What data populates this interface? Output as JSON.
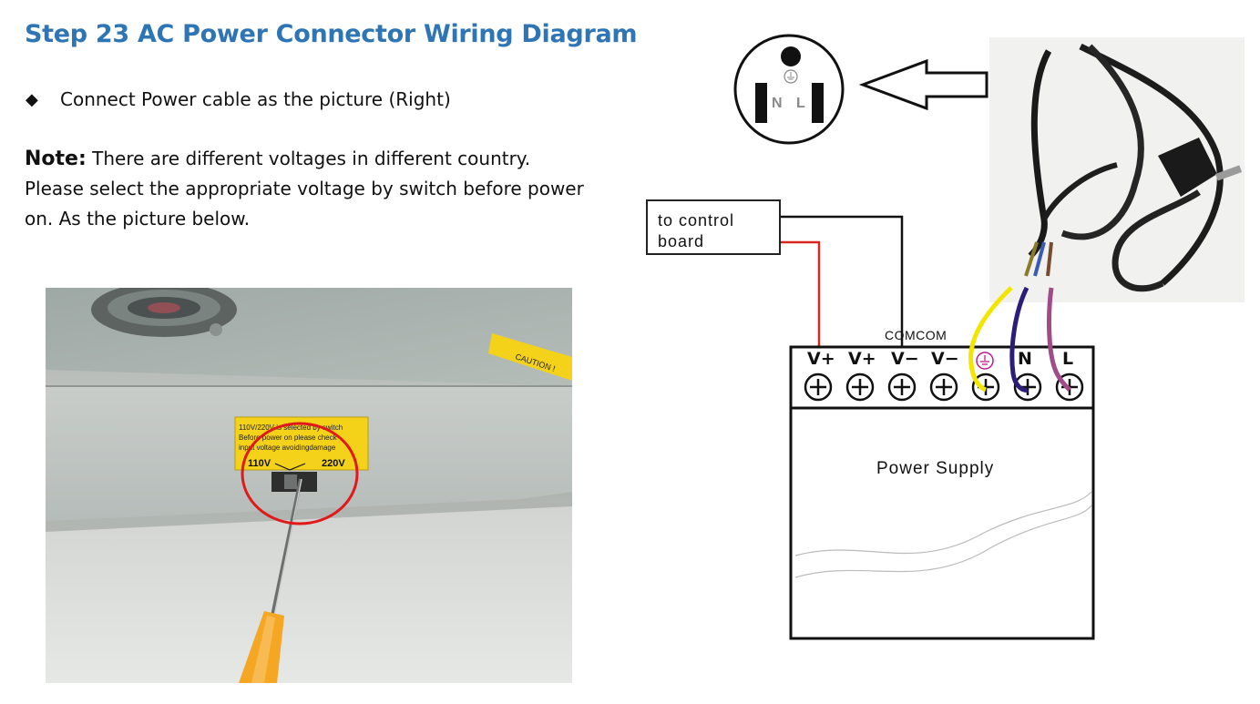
{
  "title": "Step 23  AC Power Connector Wiring Diagram",
  "bullet": {
    "symbol": "◆",
    "text": "Connect Power cable as the picture (Right)"
  },
  "note": {
    "label": "Note:",
    "text": " There are different voltages in different country. Please select the appropriate voltage by switch before power on. As the picture below."
  },
  "photo": {
    "caution_label": "CAUTION !",
    "switch_sticker_text": "110V/220V is selected by switch Before power on please check input voltage avoidingdamage",
    "switch_left": "110V",
    "switch_right": "220V"
  },
  "diagram": {
    "socket_n": "N",
    "socket_l": "L",
    "control_box_text": "to control board",
    "com_label": "COMCOM",
    "terminals": [
      "V+",
      "V+",
      "V−",
      "V−",
      "⏚",
      "N",
      "L"
    ],
    "power_supply_label": "Power Supply"
  },
  "colors": {
    "title": "#2e75b6",
    "red_wire": "#d9261c",
    "yellow_wire": "#f2e600",
    "blue_wire": "#2b1e7a",
    "purple_wire": "#a04b8a",
    "circle_highlight": "#e01a1a",
    "sticker": "#f4d21a",
    "screwdriver": "#f5a623"
  }
}
